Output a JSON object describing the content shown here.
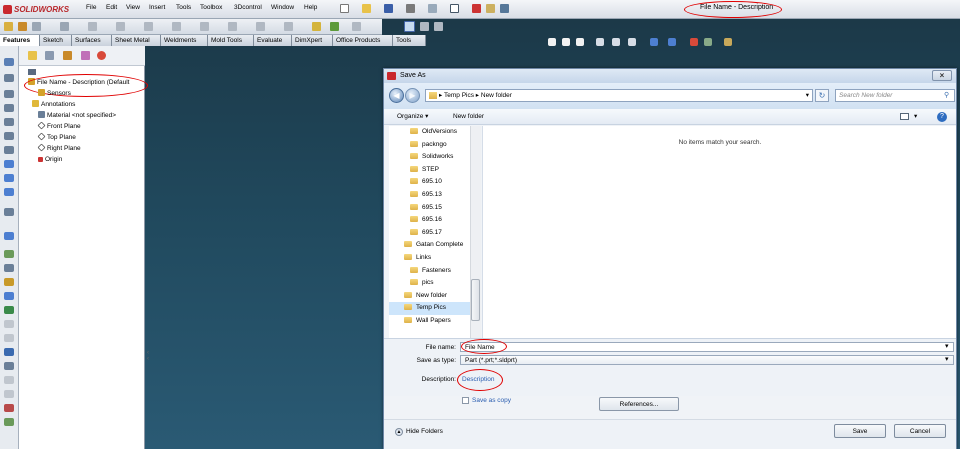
{
  "app": {
    "logo": "SOLIDWORKS",
    "document_title": "File Name - Description"
  },
  "menu": [
    "File",
    "Edit",
    "View",
    "Insert",
    "Tools",
    "Toolbox",
    "3Dcontrol",
    "Window",
    "Help"
  ],
  "tabs": [
    {
      "label": "Features",
      "active": true
    },
    {
      "label": "Sketch"
    },
    {
      "label": "Surfaces"
    },
    {
      "label": "Sheet Metal"
    },
    {
      "label": "Weldments"
    },
    {
      "label": "Mold Tools"
    },
    {
      "label": "Evaluate"
    },
    {
      "label": "DimXpert"
    },
    {
      "label": "Office Products"
    },
    {
      "label": "Tools"
    }
  ],
  "feature_tree": {
    "root": "File Name - Description  (Default",
    "items": [
      "Sensors",
      "Annotations",
      "Material <not specified>",
      "Front Plane",
      "Top Plane",
      "Right Plane",
      "Origin"
    ]
  },
  "dialog": {
    "title": "Save As",
    "close": "×",
    "breadcrumb": [
      "Temp Pics",
      "New folder"
    ],
    "search_placeholder": "Search New folder",
    "organize": "Organize ▾",
    "new_folder": "New folder",
    "folders": [
      {
        "name": "OldVersions",
        "indent": 2
      },
      {
        "name": "packngo",
        "indent": 2
      },
      {
        "name": "Solidworks",
        "indent": 2
      },
      {
        "name": "STEP",
        "indent": 2
      },
      {
        "name": "695.10",
        "indent": 2
      },
      {
        "name": "695.13",
        "indent": 2
      },
      {
        "name": "695.15",
        "indent": 2
      },
      {
        "name": "695.16",
        "indent": 2
      },
      {
        "name": "695.17",
        "indent": 2
      },
      {
        "name": "Gatan Complete",
        "indent": 1
      },
      {
        "name": "Links",
        "indent": 1
      },
      {
        "name": "Fasteners",
        "indent": 2
      },
      {
        "name": "pics",
        "indent": 2
      },
      {
        "name": "New folder",
        "indent": 1
      },
      {
        "name": "Temp Pics",
        "indent": 1,
        "selected": true
      },
      {
        "name": "Wall Papers",
        "indent": 1
      }
    ],
    "empty_message": "No items match your search.",
    "file_name_label": "File name:",
    "file_name_value": "File Name",
    "save_type_label": "Save as type:",
    "save_type_value": "Part (*.prt;*.sldprt)",
    "description_label": "Description:",
    "description_value": "Description",
    "save_as_copy": "Save as copy",
    "references": "References...",
    "hide_folders": "Hide Folders",
    "save": "Save",
    "cancel": "Cancel"
  },
  "colors": {
    "accent": "#c9282d",
    "highlight_ring": "#e00000",
    "link": "#2a5db0"
  }
}
